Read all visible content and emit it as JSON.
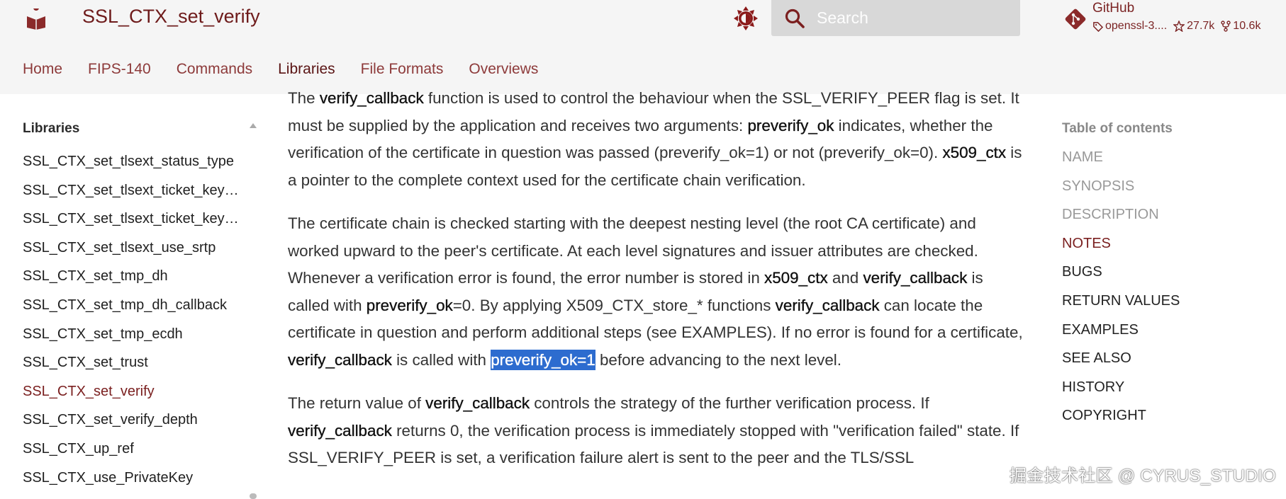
{
  "header": {
    "site_title": "SSL_CTX_set_verify",
    "search": {
      "placeholder": "Search"
    },
    "repo": {
      "name": "GitHub",
      "version": "openssl-3....",
      "stars": "27.7k",
      "forks": "10.6k"
    }
  },
  "tabs": [
    {
      "label": "Home"
    },
    {
      "label": "FIPS-140"
    },
    {
      "label": "Commands"
    },
    {
      "label": "Libraries",
      "active": true
    },
    {
      "label": "File Formats"
    },
    {
      "label": "Overviews"
    }
  ],
  "sidebar": {
    "title": "Libraries",
    "items": [
      "SSL_CTX_set_tlsext_status_type",
      "SSL_CTX_set_tlsext_ticket_key…",
      "SSL_CTX_set_tlsext_ticket_key…",
      "SSL_CTX_set_tlsext_use_srtp",
      "SSL_CTX_set_tmp_dh",
      "SSL_CTX_set_tmp_dh_callback",
      "SSL_CTX_set_tmp_ecdh",
      "SSL_CTX_set_trust",
      "SSL_CTX_set_verify",
      "SSL_CTX_set_verify_depth",
      "SSL_CTX_up_ref",
      "SSL_CTX_use_PrivateKey"
    ],
    "current": "SSL_CTX_set_verify"
  },
  "content": {
    "p1": [
      "The ",
      "verify_callback",
      " function is used to control the behaviour when the SSL_VERIFY_PEER flag is set. It must be supplied by the application and receives two arguments: ",
      "preverify_ok",
      " indicates, whether the verification of the certificate in question was passed (preverify_ok=1) or not (preverify_ok=0). ",
      "x509_ctx",
      " is a pointer to the complete context used for the certificate chain verification."
    ],
    "p2": [
      "The certificate chain is checked starting with the deepest nesting level (the root CA certificate) and worked upward to the peer's certificate. At each level signatures and issuer attributes are checked. Whenever a verification error is found, the error number is stored in ",
      "x509_ctx",
      " and ",
      "verify_callback",
      " is called with ",
      "preverify_ok",
      "=0. By applying X509_CTX_store_* functions ",
      "verify_callback",
      " can locate the certificate in question and perform additional steps (see EXAMPLES). If no error is found for a certificate, ",
      "verify_callback",
      " is called with ",
      "preverify_ok=1",
      " before advancing to the next level."
    ],
    "p3": [
      "The return value of ",
      "verify_callback",
      " controls the strategy of the further verification process. If ",
      "verify_callback",
      " returns 0, the verification process is immediately stopped with \"verification failed\" state. If SSL_VERIFY_PEER is set, a verification failure alert is sent to the peer and the TLS/SSL"
    ]
  },
  "toc": {
    "title": "Table of contents",
    "items": [
      {
        "label": "NAME",
        "state": "muted"
      },
      {
        "label": "SYNOPSIS",
        "state": "muted"
      },
      {
        "label": "DESCRIPTION",
        "state": "muted"
      },
      {
        "label": "NOTES",
        "state": "current"
      },
      {
        "label": "BUGS",
        "state": "normal"
      },
      {
        "label": "RETURN VALUES",
        "state": "normal"
      },
      {
        "label": "EXAMPLES",
        "state": "normal"
      },
      {
        "label": "SEE ALSO",
        "state": "normal"
      },
      {
        "label": "HISTORY",
        "state": "normal"
      },
      {
        "label": "COPYRIGHT",
        "state": "normal"
      }
    ]
  },
  "watermark": "掘金技术社区 @ CYRUS_STUDIO",
  "colors": {
    "brand": "#7b2424",
    "header_bg": "#f5f5f5",
    "search_bg": "#d8d8d8",
    "selection": "#2d6ccf"
  }
}
